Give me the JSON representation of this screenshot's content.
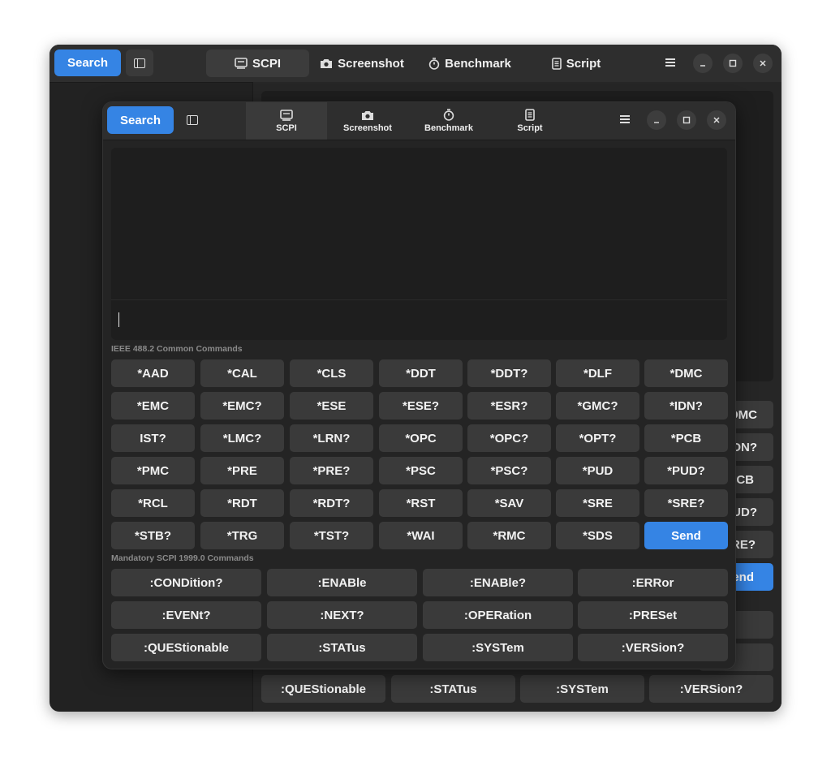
{
  "back_window": {
    "search_label": "Search",
    "tabs": [
      {
        "label": "SCPI",
        "icon": "terminal-icon",
        "active": true
      },
      {
        "label": "Screenshot",
        "icon": "camera-icon",
        "active": false
      },
      {
        "label": "Benchmark",
        "icon": "stopwatch-icon",
        "active": false
      },
      {
        "label": "Script",
        "icon": "document-icon",
        "active": false
      }
    ],
    "visible_buttons_col4": [
      "DMC",
      "ON?",
      "PCB",
      "UD?",
      "RE?"
    ],
    "send_partial": "end",
    "scpi_row3": [
      ":QUEStionable",
      ":STATus",
      ":SYSTem",
      ":VERSion?"
    ]
  },
  "front_window": {
    "search_label": "Search",
    "tabs": [
      {
        "label": "SCPI",
        "icon": "terminal-icon",
        "active": true
      },
      {
        "label": "Screenshot",
        "icon": "camera-icon",
        "active": false
      },
      {
        "label": "Benchmark",
        "icon": "stopwatch-icon",
        "active": false
      },
      {
        "label": "Script",
        "icon": "document-icon",
        "active": false
      }
    ],
    "output": "",
    "input_value": "",
    "ieee_section_label": "IEEE 488.2 Common Commands",
    "ieee_commands": [
      [
        "*AAD",
        "*CAL",
        "*CLS",
        "*DDT",
        "*DDT?",
        "*DLF",
        "*DMC"
      ],
      [
        "*EMC",
        "*EMC?",
        "*ESE",
        "*ESE?",
        "*ESR?",
        "*GMC?",
        "*IDN?"
      ],
      [
        "IST?",
        "*LMC?",
        "*LRN?",
        "*OPC",
        "*OPC?",
        "*OPT?",
        "*PCB"
      ],
      [
        "*PMC",
        "*PRE",
        "*PRE?",
        "*PSC",
        "*PSC?",
        "*PUD",
        "*PUD?"
      ],
      [
        "*RCL",
        "*RDT",
        "*RDT?",
        "*RST",
        "*SAV",
        "*SRE",
        "*SRE?"
      ],
      [
        "*STB?",
        "*TRG",
        "*TST?",
        "*WAI",
        "*RMC",
        "*SDS"
      ]
    ],
    "send_label": "Send",
    "scpi_section_label": "Mandatory SCPI 1999.0 Commands",
    "scpi_commands": [
      [
        ":CONDition?",
        ":ENABle",
        ":ENABle?",
        ":ERRor"
      ],
      [
        ":EVENt?",
        ":NEXT?",
        ":OPERation",
        ":PRESet"
      ],
      [
        ":QUEStionable",
        ":STATus",
        ":SYSTem",
        ":VERSion?"
      ]
    ],
    "colors": {
      "accent": "#3584e4",
      "button": "#3a3a3a",
      "window": "#242424"
    }
  }
}
